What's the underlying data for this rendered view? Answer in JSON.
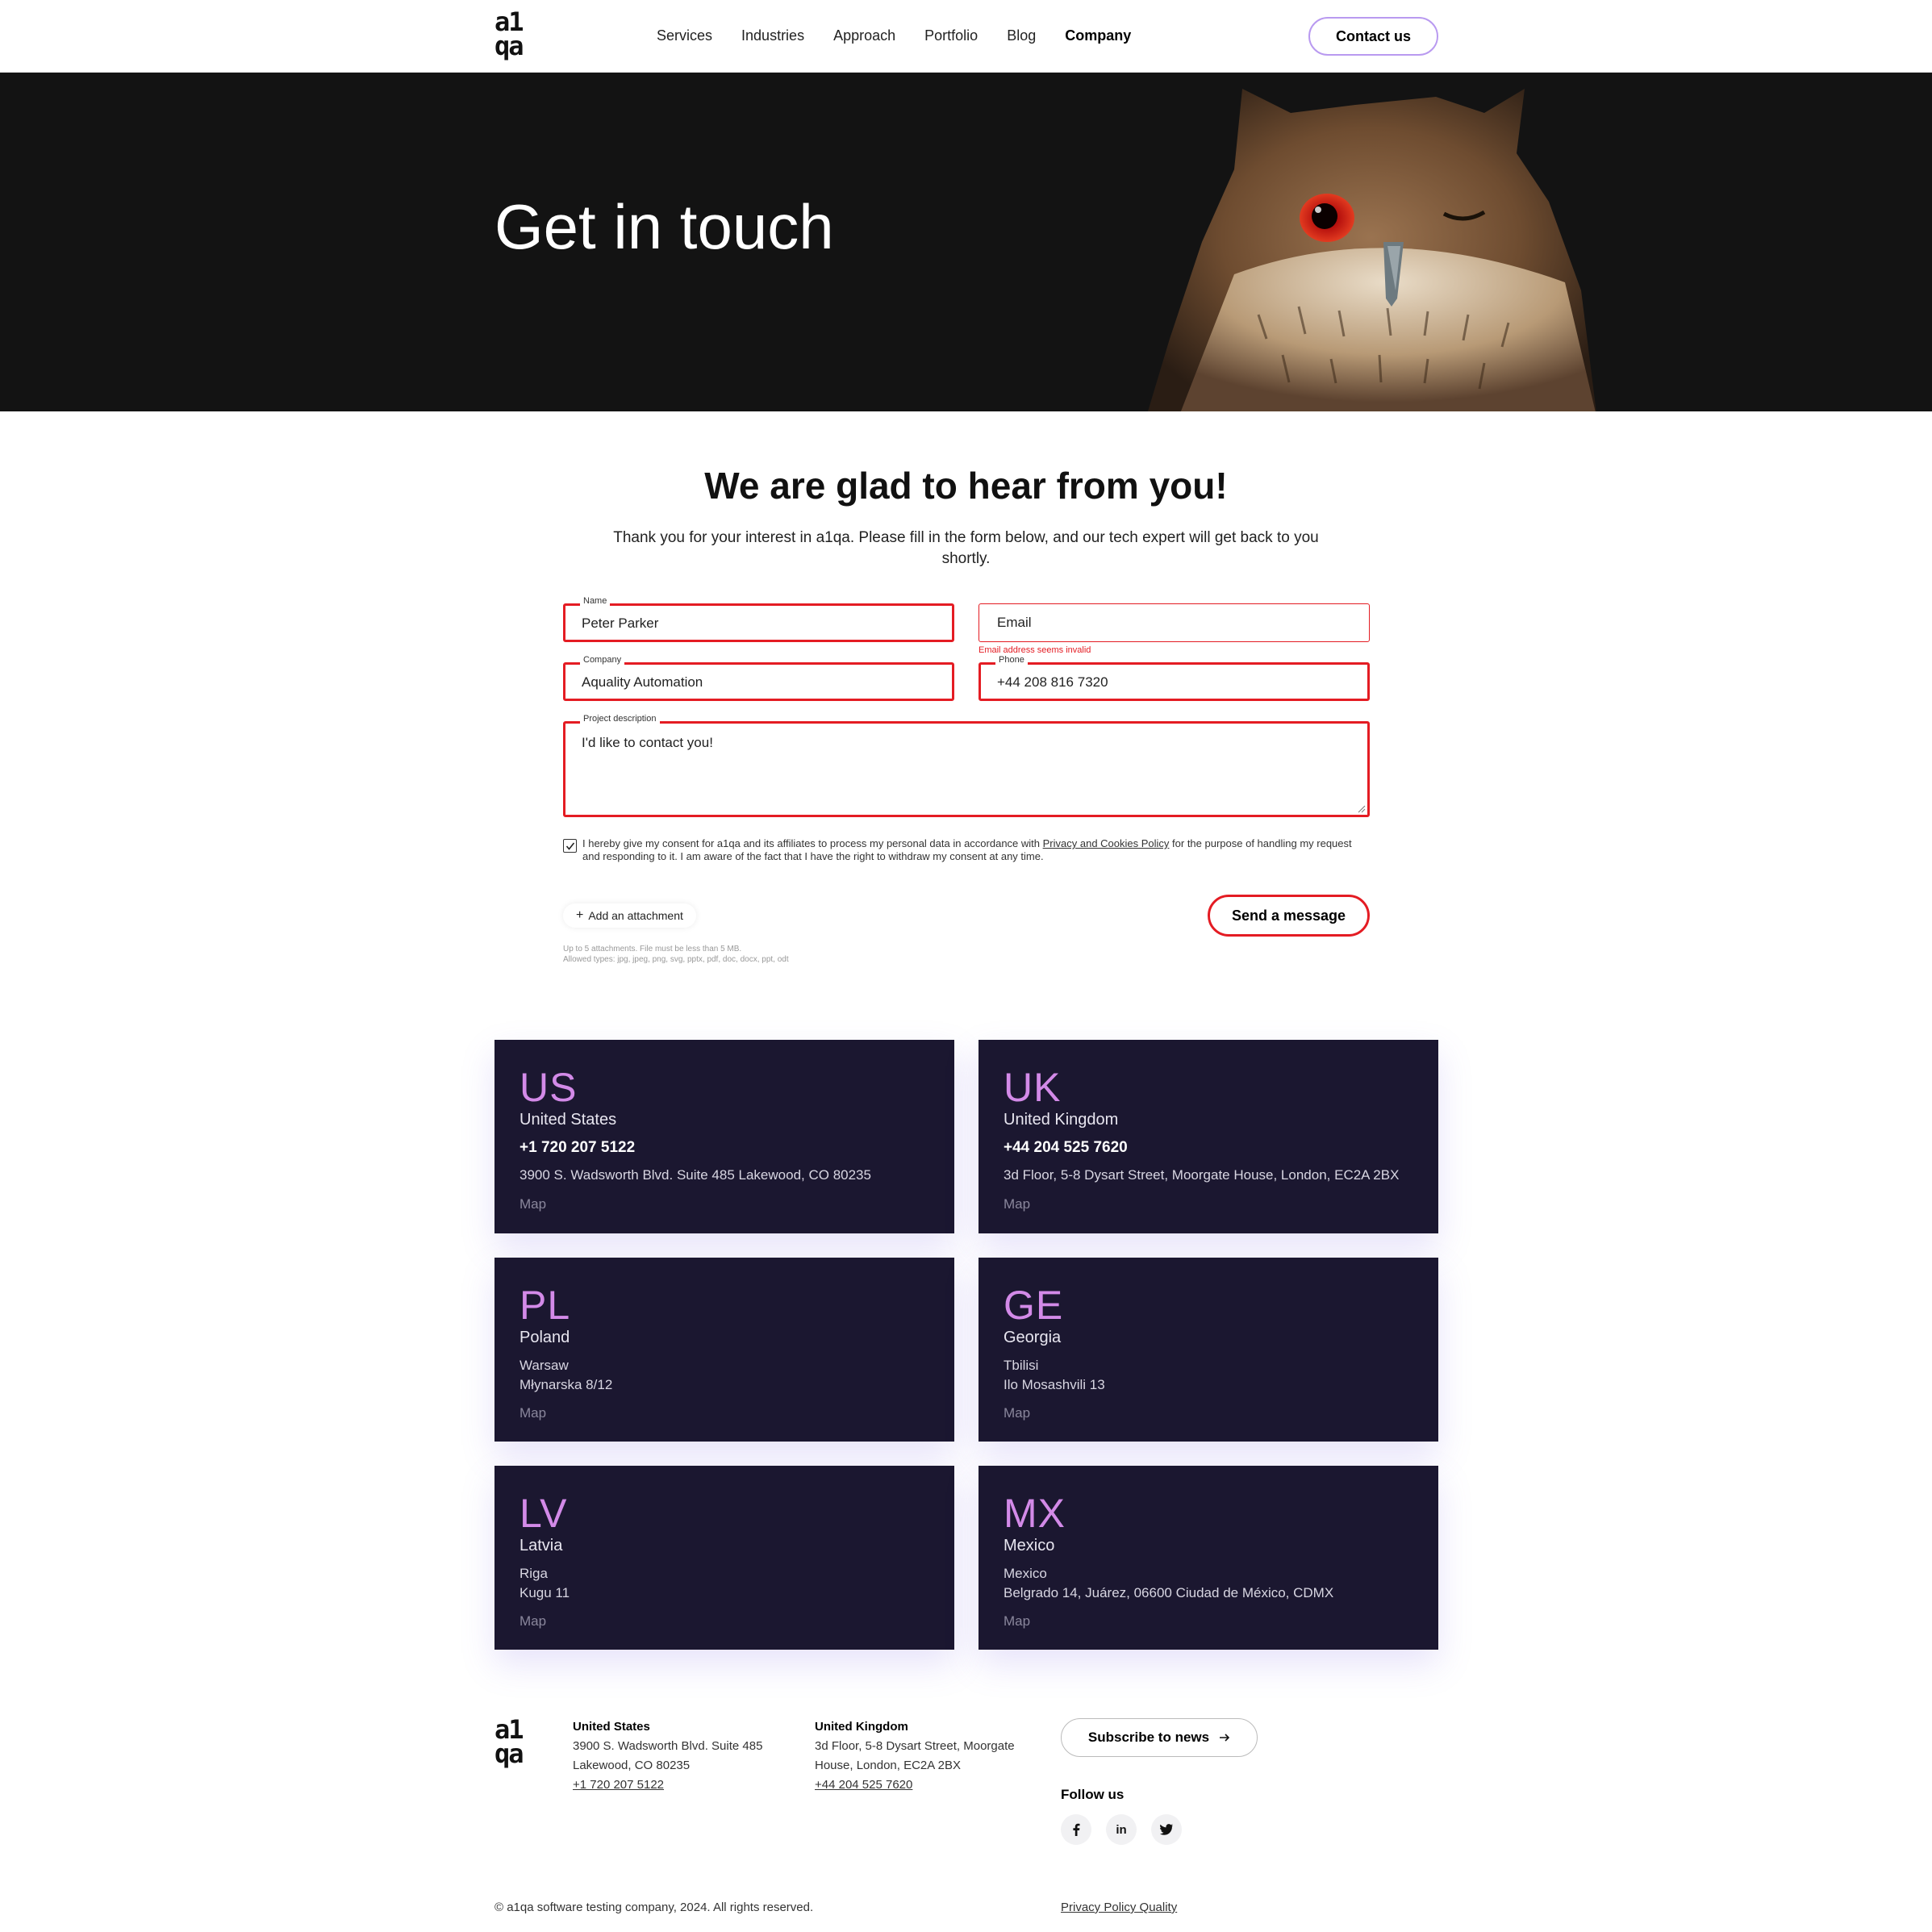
{
  "header": {
    "logo": "a1qa",
    "nav": [
      "Services",
      "Industries",
      "Approach",
      "Portfolio",
      "Blog",
      "Company"
    ],
    "active_nav": "Company",
    "contact_label": "Contact us"
  },
  "hero": {
    "title": "Get in touch"
  },
  "form": {
    "heading": "We are glad to hear from you!",
    "intro": "Thank you for your interest in a1qa. Please fill in the form below, and our tech expert will get back to you shortly.",
    "name_label": "Name",
    "name_value": "Peter Parker",
    "email_placeholder": "Email",
    "email_error": "Email address seems invalid",
    "company_label": "Company",
    "company_value": "Aquality Automation",
    "phone_label": "Phone",
    "phone_value": "+44 208 816 7320",
    "project_label": "Project description",
    "project_value": "I'd like to contact you!",
    "consent_before": "I hereby give my consent for a1qa and its affiliates to process my personal data in accordance with ",
    "consent_link": "Privacy and Cookies Policy",
    "consent_after": " for the purpose of handling my request and responding to it. I am aware of the fact that I have the right to withdraw my consent at any time.",
    "attach_label": "Add an attachment",
    "attach_note_1": "Up to 5 attachments. File must be less than 5 MB.",
    "attach_note_2": "Allowed types: jpg, jpeg, png, svg, pptx, pdf, doc, docx, ppt, odt",
    "send_label": "Send a message"
  },
  "offices": [
    {
      "code": "US",
      "country": "United States",
      "phone": "+1 720 207 5122",
      "address": "3900 S. Wadsworth Blvd. Suite 485 Lakewood, CO 80235",
      "map": "Map"
    },
    {
      "code": "UK",
      "country": "United Kingdom",
      "phone": "+44 204 525 7620",
      "address": "3d Floor, 5-8 Dysart Street, Moorgate House, London, EC2A 2BX",
      "map": "Map"
    },
    {
      "code": "PL",
      "country": "Poland",
      "city": "Warsaw",
      "address": "Młynarska 8/12",
      "map": "Map"
    },
    {
      "code": "GE",
      "country": "Georgia",
      "city": "Tbilisi",
      "address": "Ilo Mosashvili 13",
      "map": "Map"
    },
    {
      "code": "LV",
      "country": "Latvia",
      "city": "Riga",
      "address": "Kugu 11",
      "map": "Map"
    },
    {
      "code": "MX",
      "country": "Mexico",
      "city": "Mexico",
      "address": "Belgrado 14, Juárez, 06600 Ciudad de México, CDMX",
      "map": "Map"
    }
  ],
  "footer": {
    "logo": "a1qa",
    "us": {
      "title": "United States",
      "line1": "3900 S. Wadsworth Blvd. Suite 485",
      "line2": "Lakewood, CO 80235",
      "phone": "+1 720 207 5122"
    },
    "uk": {
      "title": "United Kingdom",
      "line1": "3d Floor, 5-8 Dysart Street, Moorgate",
      "line2": "House, London, EC2A 2BX",
      "phone": "+44 204 525 7620"
    },
    "subscribe_label": "Subscribe to news",
    "follow_label": "Follow us",
    "social": [
      "facebook-icon",
      "linkedin-icon",
      "twitter-icon"
    ],
    "copyright": "© a1qa software testing company, 2024. All rights reserved.",
    "policy": "Privacy Policy Quality"
  },
  "colors": {
    "accent_red": "#e41c23",
    "card_bg": "#1b1730",
    "card_code": "#d38ae8",
    "contact_border": "#b99af0"
  }
}
